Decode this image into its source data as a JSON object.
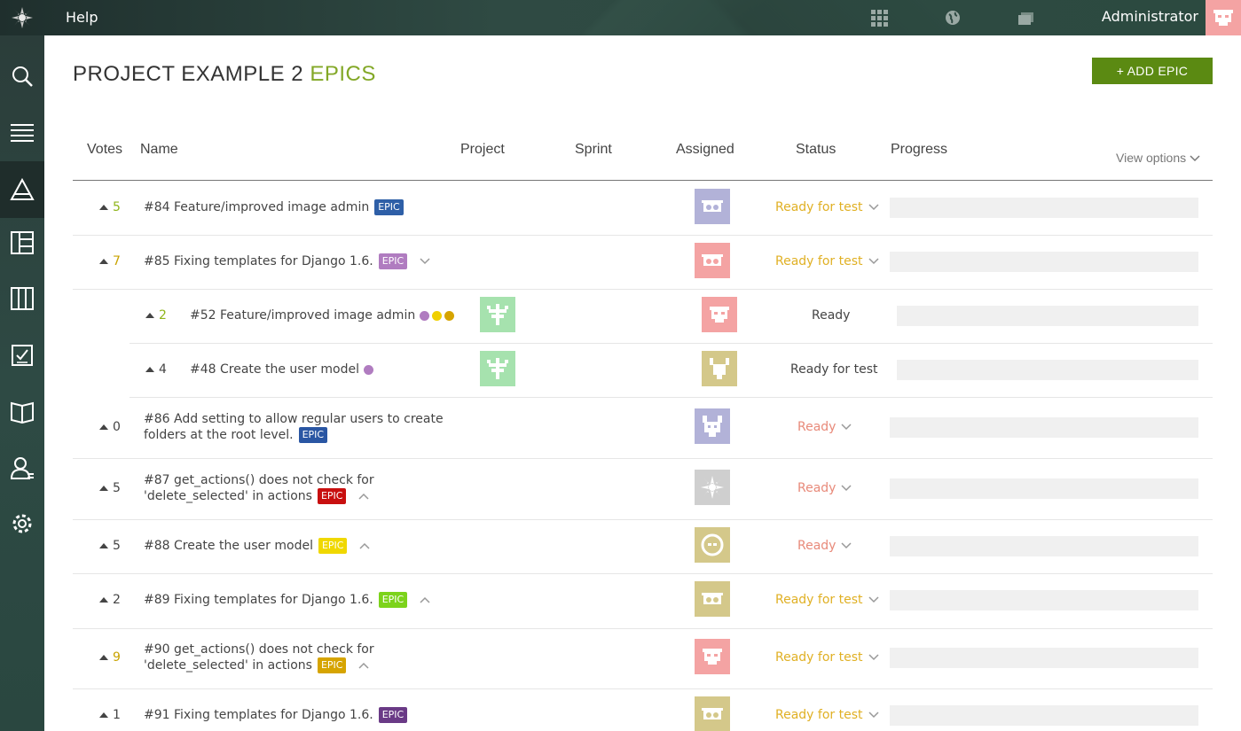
{
  "topbar": {
    "help": "Help",
    "user_name": "Administrator",
    "icons": [
      "grid-icon",
      "globe-icon",
      "folders-icon"
    ]
  },
  "sidebar": {
    "items": [
      "search-icon",
      "backlog-icon",
      "epics-icon",
      "kanban-icon",
      "sprints-icon",
      "issues-icon",
      "wiki-icon",
      "team-icon",
      "settings-icon"
    ],
    "active": "epics-icon"
  },
  "page": {
    "project": "PROJECT EXAMPLE 2",
    "section": "EPICS",
    "add_button": "+ ADD EPIC"
  },
  "table": {
    "headers": {
      "votes": "Votes",
      "name": "Name",
      "project": "Project",
      "sprint": "Sprint",
      "assigned": "Assigned",
      "status": "Status",
      "progress": "Progress"
    },
    "view_options": "View options",
    "rows": [
      {
        "votes": "5",
        "line1": "#84 Feature/improved image admin",
        "line2": "",
        "tag": "EPIC",
        "tag_color": "#2e5fa7",
        "status": "Ready for test"
      },
      {
        "votes": "7",
        "line1": "#85 Fixing templates for Django 1.6.",
        "line2": "",
        "tag": "EPIC",
        "tag_color": "#b07cc0",
        "status": "Ready for test"
      },
      {
        "votes": "2",
        "line1": "#52 Feature/improved image admin",
        "status": "Ready"
      },
      {
        "votes": "4",
        "line1": "#48 Create the user model",
        "status": "Ready for test"
      },
      {
        "votes": "0",
        "line1": "#86 Add setting to allow regular users to create",
        "line2": "folders at the root level.",
        "tag": "EPIC",
        "tag_color": "#2a56a3",
        "status": "Ready"
      },
      {
        "votes": "5",
        "line1": "#87 get_actions() does not check for",
        "line2": "'delete_selected' in actions",
        "tag": "EPIC",
        "tag_color": "#c80f0f",
        "status": "Ready"
      },
      {
        "votes": "5",
        "line1": "#88 Create the user model",
        "line2": "",
        "tag": "EPIC",
        "tag_color": "#f0d800",
        "status": "Ready"
      },
      {
        "votes": "2",
        "line1": "#89 Fixing templates for Django 1.6.",
        "line2": "",
        "tag": "EPIC",
        "tag_color": "#7cd31b",
        "status": "Ready for test"
      },
      {
        "votes": "9",
        "line1": "#90 get_actions() does not check for",
        "line2": "'delete_selected' in actions",
        "tag": "EPIC",
        "tag_color": "#d6a400",
        "status": "Ready for test"
      },
      {
        "votes": "1",
        "line1": "#91 Fixing templates for Django 1.6.",
        "line2": "",
        "tag": "EPIC",
        "tag_color": "#6a3a86",
        "status": "Ready for test"
      }
    ]
  },
  "colors": {
    "accent_green": "#83a827",
    "button_green": "#5b8a12",
    "status_ready_for_test": "#e0b024",
    "status_ready": "#e88a7a",
    "dot_purple": "#b07cc0",
    "dot_yellow": "#f0d000",
    "dot_gold": "#d6a400"
  }
}
